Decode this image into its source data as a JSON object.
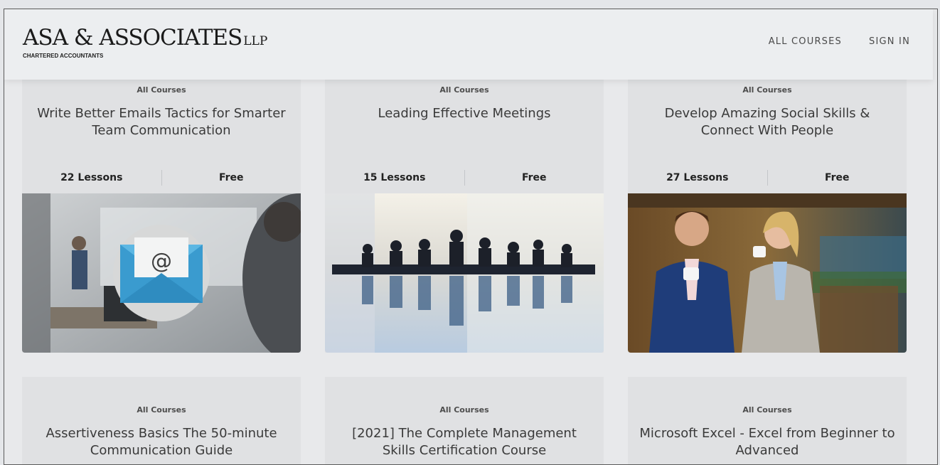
{
  "header": {
    "logo_main": "ASA & ASSOCIATES",
    "logo_llp": "LLP",
    "logo_sub": "CHARTERED ACCOUNTANTS",
    "nav": [
      "ALL COURSES",
      "SIGN IN"
    ]
  },
  "courses": [
    {
      "category": "All Courses",
      "title": "Write Better Emails Tactics for Smarter Team Communication",
      "lessons": "22 Lessons",
      "price": "Free",
      "image": "email-envelope-office-illustration"
    },
    {
      "category": "All Courses",
      "title": "Leading Effective Meetings",
      "lessons": "15 Lessons",
      "price": "Free",
      "image": "meeting-silhouettes-reflection"
    },
    {
      "category": "All Courses",
      "title": "Develop Amazing Social Skills & Connect With People",
      "lessons": "27 Lessons",
      "price": "Free",
      "image": "two-people-coffee-conversation"
    },
    {
      "category": "All Courses",
      "title": "Assertiveness Basics The 50-minute Communication Guide"
    },
    {
      "category": "All Courses",
      "title": "[2021] The Complete Management Skills Certification Course"
    },
    {
      "category": "All Courses",
      "title": "Microsoft Excel - Excel from Beginner to Advanced"
    }
  ]
}
